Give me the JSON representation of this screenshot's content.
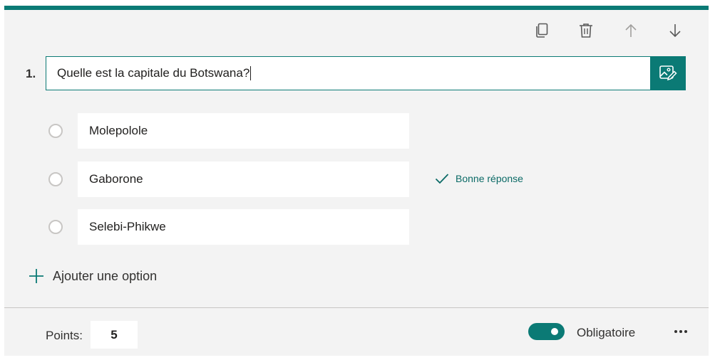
{
  "question": {
    "number": "1.",
    "text": "Quelle est la capitale du Botswana?",
    "options": [
      {
        "label": "Molepolole"
      },
      {
        "label": "Gaborone"
      },
      {
        "label": "Selebi-Phikwe"
      }
    ],
    "correct_label": "Bonne réponse",
    "add_option_label": "Ajouter une option"
  },
  "toolbar": {
    "icons": [
      "copy-icon",
      "delete-icon",
      "move-up-icon",
      "move-down-icon"
    ]
  },
  "footer": {
    "points_label": "Points:",
    "points_value": "5",
    "required_label": "Obligatoire",
    "required_on": true
  },
  "colors": {
    "accent": "#0b7a75",
    "background": "#f3f3f3"
  }
}
